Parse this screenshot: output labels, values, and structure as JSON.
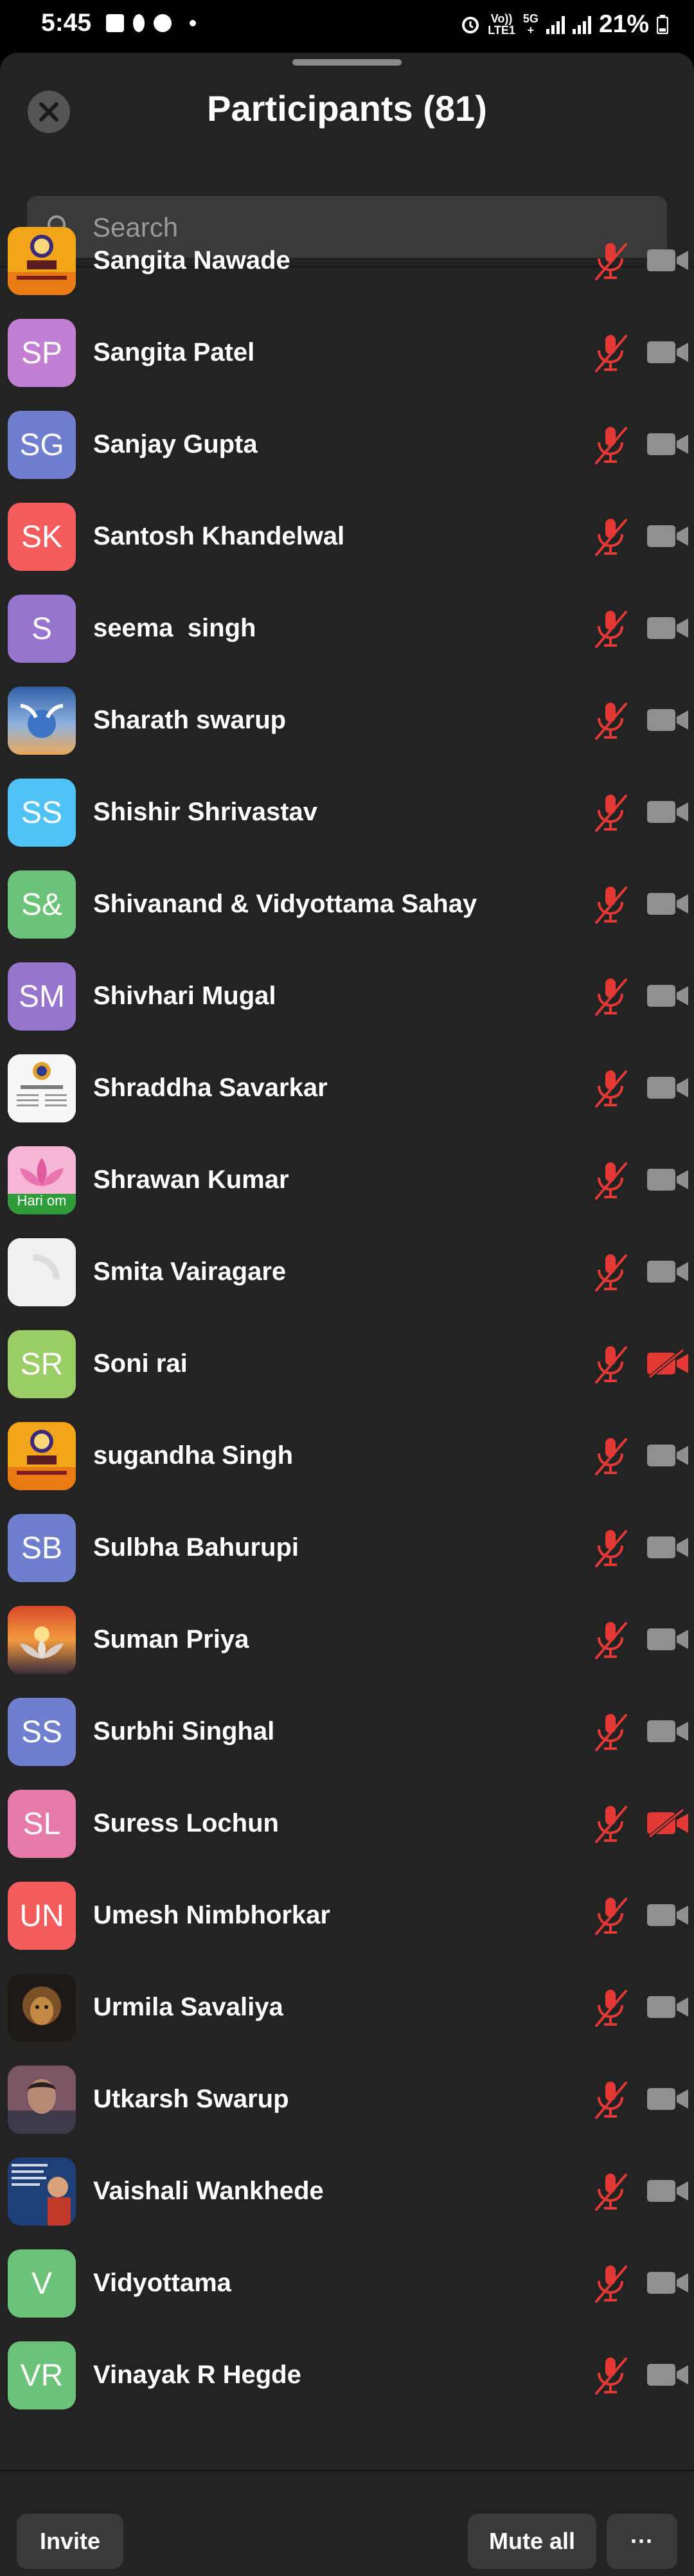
{
  "status_bar": {
    "time": "5:45",
    "volte_top": "Vo))",
    "volte_bottom": "LTE1",
    "net_top": "5G",
    "net_bottom": "+",
    "battery": "21%"
  },
  "header": {
    "title": "Participants (81)"
  },
  "search": {
    "placeholder": "Search"
  },
  "colors": {
    "background": "#232323",
    "muted_red": "#e53935",
    "cam_gray": "#8f8f8f"
  },
  "participants": [
    {
      "name": "Sangita Nawade",
      "initials": "",
      "avatar": "logo-pdl-image",
      "avatar_color": "#f2a516",
      "video_off": false
    },
    {
      "name": "Sangita Patel",
      "initials": "SP",
      "avatar": "initials",
      "avatar_color": "#c37fd2",
      "video_off": false
    },
    {
      "name": "Sanjay Gupta",
      "initials": "SG",
      "avatar": "initials",
      "avatar_color": "#6f7fcd",
      "video_off": false
    },
    {
      "name": "Santosh Khandelwal",
      "initials": "SK",
      "avatar": "initials",
      "avatar_color": "#f45d5d",
      "video_off": false
    },
    {
      "name": "seema  singh",
      "initials": "S",
      "avatar": "initials",
      "avatar_color": "#9575cd",
      "video_off": false
    },
    {
      "name": "Sharath swarup",
      "initials": "",
      "avatar": "emblem-image",
      "avatar_color": "#4a77b5",
      "video_off": false
    },
    {
      "name": "Shishir Shrivastav",
      "initials": "SS",
      "avatar": "initials",
      "avatar_color": "#4fc3f7",
      "video_off": false
    },
    {
      "name": "Shivanand & Vidyottama Sahay",
      "initials": "S&",
      "avatar": "initials",
      "avatar_color": "#6dc27a",
      "video_off": false
    },
    {
      "name": "Shivhari Mugal",
      "initials": "SM",
      "avatar": "initials",
      "avatar_color": "#9575cd",
      "video_off": false
    },
    {
      "name": "Shraddha Savarkar",
      "initials": "",
      "avatar": "document-image",
      "avatar_color": "#f5f5f5",
      "video_off": false
    },
    {
      "name": "Shrawan Kumar",
      "initials": "",
      "avatar": "lotus-image",
      "avatar_color": "#e58fbf",
      "avatar_caption": "Hari om",
      "video_off": false
    },
    {
      "name": "Smita Vairagare",
      "initials": "",
      "avatar": "white-image",
      "avatar_color": "#eeeeee",
      "video_off": false
    },
    {
      "name": "Soni rai",
      "initials": "SR",
      "avatar": "initials",
      "avatar_color": "#9ccc65",
      "video_off": true
    },
    {
      "name": "sugandha Singh",
      "initials": "",
      "avatar": "logo-pdl-image",
      "avatar_color": "#f2a516",
      "video_off": false
    },
    {
      "name": "Sulbha Bahurupi",
      "initials": "SB",
      "avatar": "initials",
      "avatar_color": "#6f7fcd",
      "video_off": false
    },
    {
      "name": "Suman Priya",
      "initials": "",
      "avatar": "sunset-lotus-image",
      "avatar_color": "#e2763a",
      "video_off": false
    },
    {
      "name": "Surbhi Singhal",
      "initials": "SS",
      "avatar": "initials",
      "avatar_color": "#6f7fcd",
      "video_off": false
    },
    {
      "name": "Suress Lochun",
      "initials": "SL",
      "avatar": "initials",
      "avatar_color": "#e57ba6",
      "video_off": true
    },
    {
      "name": "Umesh Nimbhorkar",
      "initials": "UN",
      "avatar": "initials",
      "avatar_color": "#f45d5d",
      "video_off": false
    },
    {
      "name": "Urmila Savaliya",
      "initials": "",
      "avatar": "lion-image",
      "avatar_color": "#6b4a22",
      "video_off": false
    },
    {
      "name": "Utkarsh Swarup",
      "initials": "",
      "avatar": "portrait-image",
      "avatar_color": "#7a5563",
      "video_off": false
    },
    {
      "name": "Vaishali Wankhede",
      "initials": "",
      "avatar": "poster-image",
      "avatar_color": "#2a4f8a",
      "video_off": false
    },
    {
      "name": "Vidyottama",
      "initials": "V",
      "avatar": "initials",
      "avatar_color": "#6dc27a",
      "video_off": false
    },
    {
      "name": "Vinayak R Hegde",
      "initials": "VR",
      "avatar": "initials",
      "avatar_color": "#6dc27a",
      "video_off": false
    }
  ],
  "footer": {
    "invite_label": "Invite",
    "mute_all_label": "Mute all",
    "more_label": "···"
  }
}
